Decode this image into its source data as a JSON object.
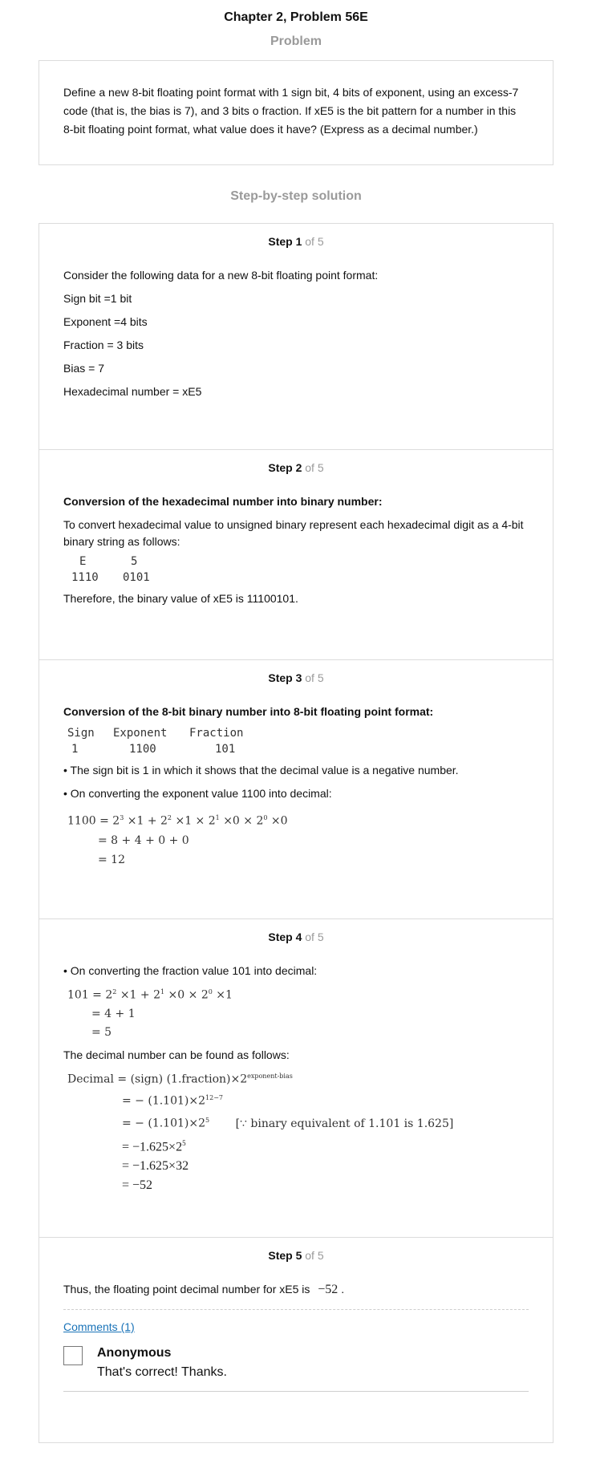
{
  "page_title": "Chapter 2, Problem 56E",
  "problem": {
    "heading": "Problem",
    "text": "Define a new 8-bit floating point format with 1 sign bit, 4 bits of exponent, using an excess-7 code (that is, the bias is 7), and 3 bits o fraction. If xE5 is the bit pattern for a number in this 8-bit floating point format, what value does it have? (Express as a decimal number.)"
  },
  "solution_heading": "Step-by-step solution",
  "step_of": "of 5",
  "steps": [
    {
      "label": "Step 1",
      "intro": "Consider the following data for a new 8-bit floating point format:",
      "lines": [
        "Sign bit =1 bit",
        "Exponent =4 bits",
        "Fraction = 3 bits",
        "Bias = 7",
        "Hexadecimal number = xE5"
      ]
    },
    {
      "label": "Step 2",
      "heading": "Conversion of the hexadecimal number into binary number:",
      "text": "To convert hexadecimal value to unsigned binary represent each hexadecimal digit as a 4-bit binary string as follows:",
      "hex_digits": [
        "E",
        "5"
      ],
      "bin_digits": [
        "1110",
        "0101"
      ],
      "conclusion": "Therefore, the binary value of xE5 is 11100101."
    },
    {
      "label": "Step 3",
      "heading": "Conversion of the 8-bit binary number into 8-bit floating point format:",
      "table_headers": [
        "Sign",
        "Exponent",
        "Fraction"
      ],
      "table_values": [
        "1",
        "1100",
        "101"
      ],
      "bullet1": "• The sign bit is 1 in which it shows that the decimal value is a negative number.",
      "bullet2": "• On converting the exponent value 1100 into decimal:",
      "eq_lhs": "1100",
      "eq2": "= 8 + 4 + 0 + 0",
      "eq3": "= 12"
    },
    {
      "label": "Step 4",
      "bullet": "• On converting the fraction value 101 into decimal:",
      "eq_lhs": "101",
      "eq2": "= 4 + 1",
      "eq3": "= 5",
      "text": "The decimal number can be found as follows:",
      "dec_lhs": "Decimal",
      "dec_rhs": "= (sign) (1.fraction)×2",
      "dec_sup": "exponent-bias",
      "l2": "= − (1.101)×2",
      "l2_sup": "12−7",
      "l3": "= − (1.101)×2",
      "l3_sup": "5",
      "l3_note": "[∵ binary equivalent of 1.101 is 1.625]",
      "l4": "= −1.625×2",
      "l4_sup": "5",
      "l5": "= −1.625×32",
      "l6": "= −52"
    },
    {
      "label": "Step 5",
      "text": "Thus, the floating point decimal number for xE5 is",
      "answer": "−52",
      "period": "."
    }
  ],
  "comments": {
    "link": "Comments (1)",
    "author": "Anonymous",
    "text": "That's correct! Thanks."
  }
}
